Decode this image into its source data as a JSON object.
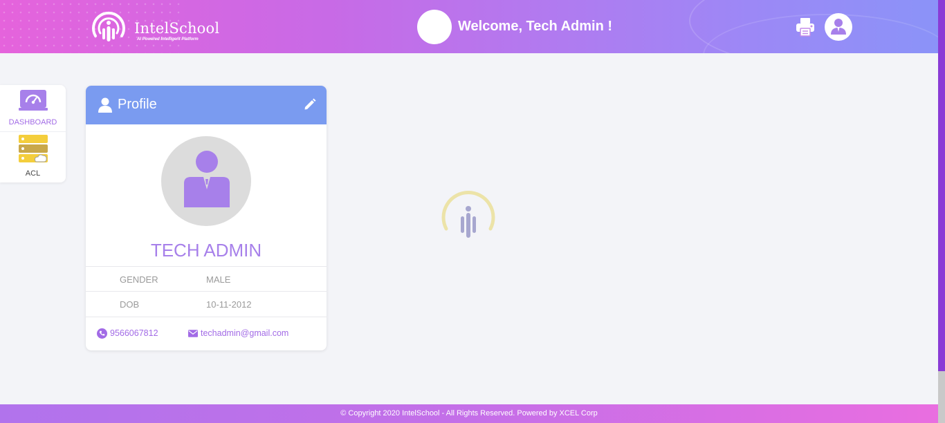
{
  "header": {
    "logo_name": "IntelSchool",
    "logo_tagline": "AI Powered Intelligent Platform",
    "welcome": "Welcome, Tech Admin !",
    "print_icon": "printer-icon",
    "user_icon": "user-avatar-icon"
  },
  "sidebar": {
    "items": [
      {
        "label": "DASHBOARD",
        "icon": "dashboard-gauge-icon"
      },
      {
        "label": "ACL",
        "icon": "server-cloud-icon"
      }
    ]
  },
  "profile": {
    "title": "Profile",
    "name": "TECH ADMIN",
    "fields": [
      {
        "key": "GENDER",
        "value": "MALE"
      },
      {
        "key": "DOB",
        "value": "10-11-2012"
      }
    ],
    "phone": "9566067812",
    "email": "techadmin@gmail.com"
  },
  "footer": {
    "text": "© Copyright 2020 IntelSchool - All Rights Reserved. Powered by XCEL Corp"
  },
  "colors": {
    "accent": "#a780ea",
    "card_header": "#7a9bf0",
    "nav_active": "#a26be6"
  }
}
